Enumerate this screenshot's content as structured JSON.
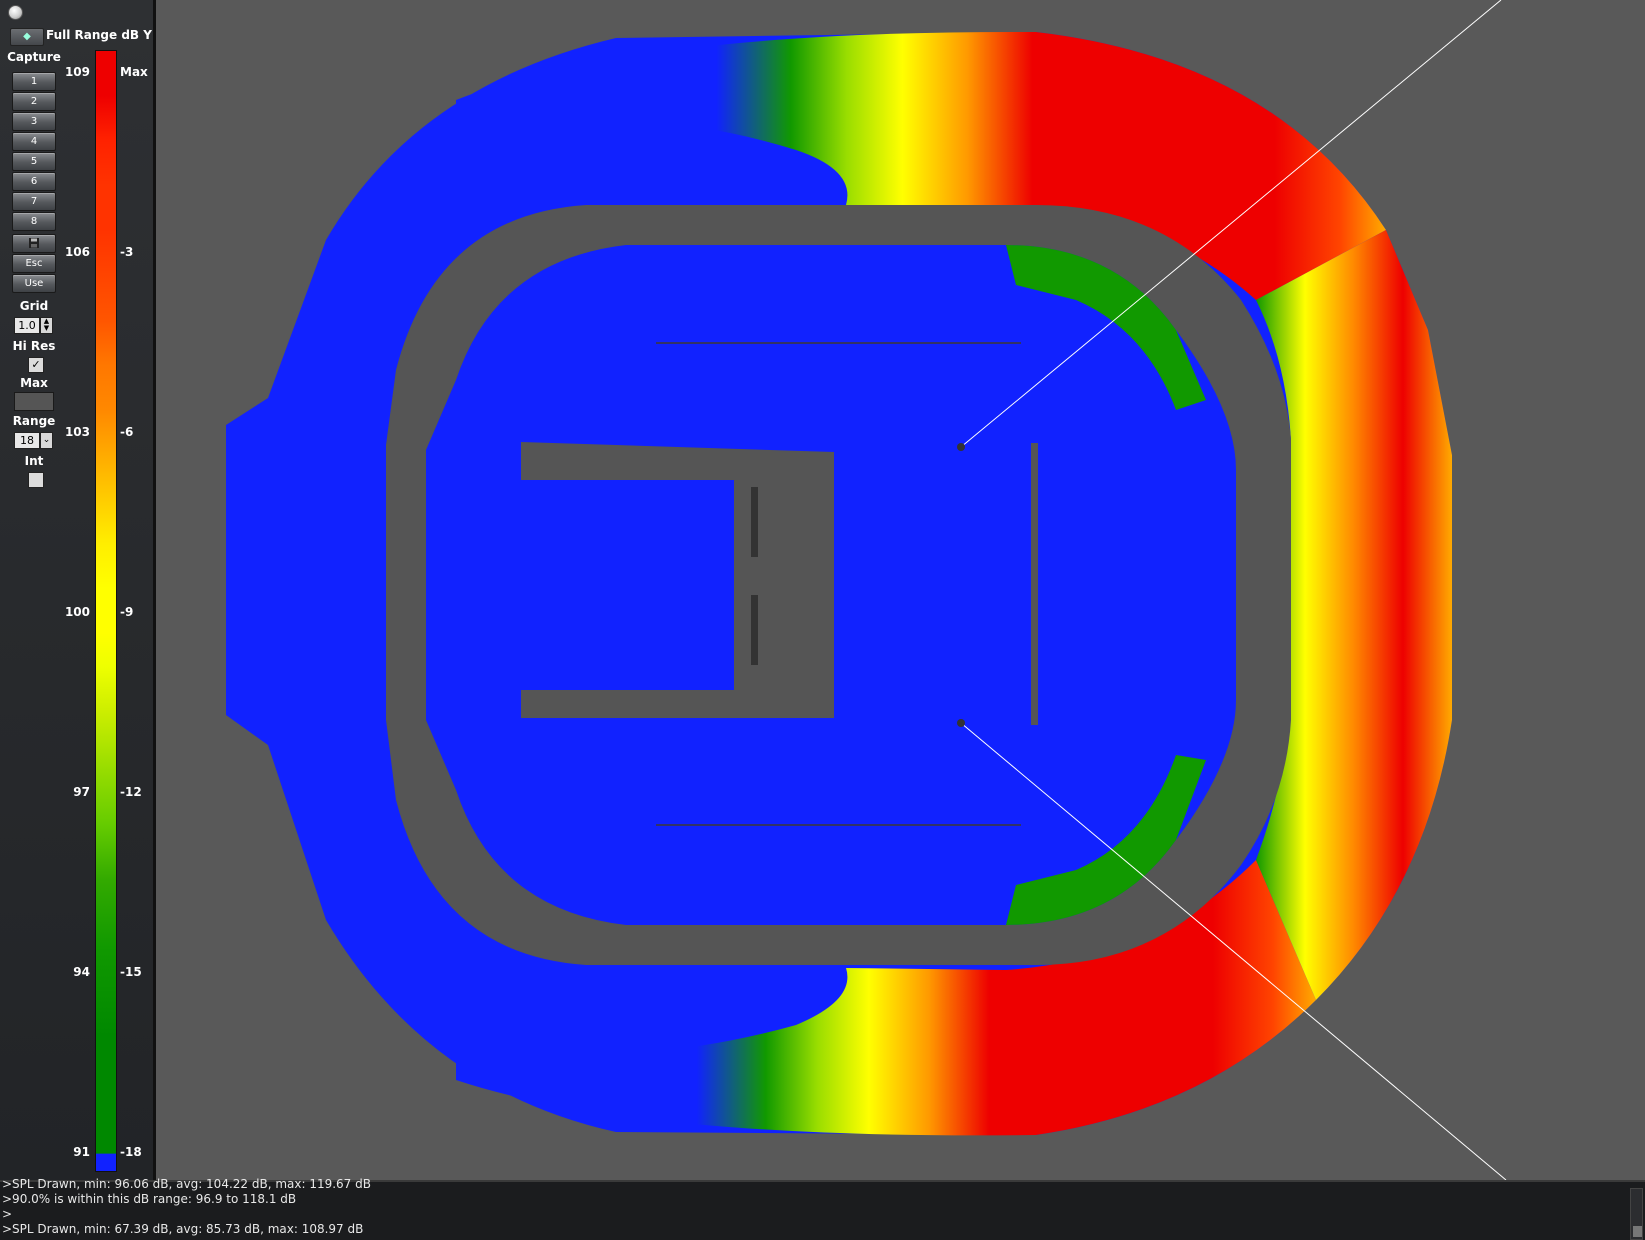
{
  "toolbar": {
    "mode_label": "Full Range dB Y",
    "capture_label": "Capture",
    "capture_buttons": [
      "1",
      "2",
      "3",
      "4",
      "5",
      "6",
      "7",
      "8"
    ],
    "esc_label": "Esc",
    "use_label": "Use",
    "grid_label": "Grid",
    "grid_value": "1.0",
    "hires_label": "Hi Res",
    "hires_checked": "✓",
    "max_label": "Max",
    "range_label": "Range",
    "range_value": "18",
    "int_label": "Int"
  },
  "scale": {
    "left_ticks": [
      "109",
      "106",
      "103",
      "100",
      "97",
      "94",
      "91"
    ],
    "right_ticks": [
      "Max",
      "-3",
      "-6",
      "-9",
      "-12",
      "-15",
      "-18"
    ],
    "colors": {
      "max": "#ee0000",
      "orange": "#ff8800",
      "yellow": "#ffff00",
      "green": "#119900",
      "below_range": "#1122ff",
      "background": "#595959",
      "structure": "#555555"
    }
  },
  "icons": {
    "save": "floppy-disk-icon",
    "dropdown": "display-mode-icon"
  },
  "console": {
    "lines": [
      ">SPL Drawn, min: 96.06 dB, avg: 104.22 dB, max: 119.67 dB",
      ">90.0% is within this dB range: 96.9 to 118.1 dB",
      ">",
      ">SPL Drawn, min: 67.39 dB, avg: 85.73 dB, max: 108.97 dB"
    ]
  }
}
